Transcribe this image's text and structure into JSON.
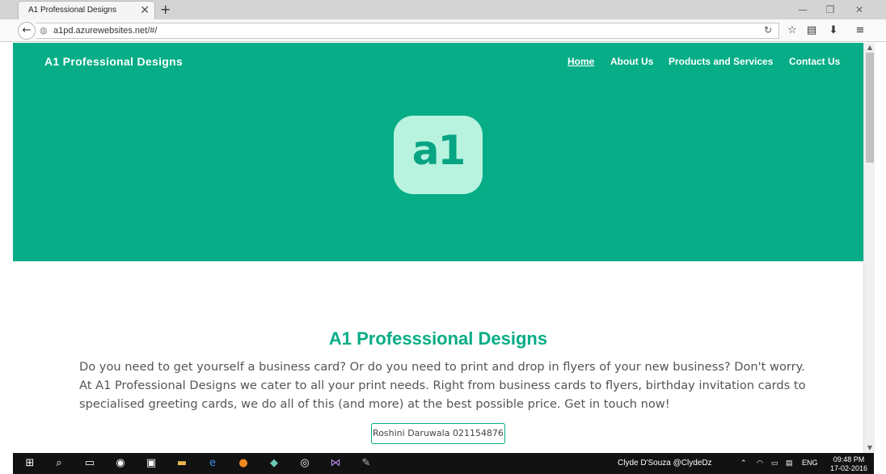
{
  "browser": {
    "tab_title": "A1 Professional Designs",
    "tab_close": "✕",
    "new_tab": "+",
    "back": "←",
    "url": "a1pd.azurewebsites.net/#/",
    "reload": "↻",
    "window_minimize": "—",
    "window_restore": "❐",
    "window_close": "✕",
    "toolbar_icons": [
      "bookmark-star-icon",
      "reading-list-icon",
      "download-icon",
      "menu-icon"
    ]
  },
  "site": {
    "brand": "A1 Professional Designs",
    "nav": [
      {
        "label": "Home",
        "active": true
      },
      {
        "label": "About Us",
        "active": false
      },
      {
        "label": "Products and Services",
        "active": false
      },
      {
        "label": "Contact Us",
        "active": false
      }
    ],
    "logo_text": "a1",
    "heading": "A1 Professsional Designs",
    "body": "Do you need to get yourself a business card? Or do you need to print and drop in flyers of your new business? Don't worry. At A1 Professional Designs we cater to all your print needs. Right from business cards to flyers, birthday invitation cards to specialised greeting cards, we do all of this (and more) at the best possible price. Get in touch now!",
    "contact_button": "Roshini Daruwala 021154876",
    "colors": {
      "accent": "#06ad86",
      "logo_bg": "#b8f3df"
    }
  },
  "taskbar": {
    "user": "Clyde D'Souza @ClydeDz",
    "language": "ENG",
    "time": "09:48 PM",
    "date": "17-02-2016"
  }
}
